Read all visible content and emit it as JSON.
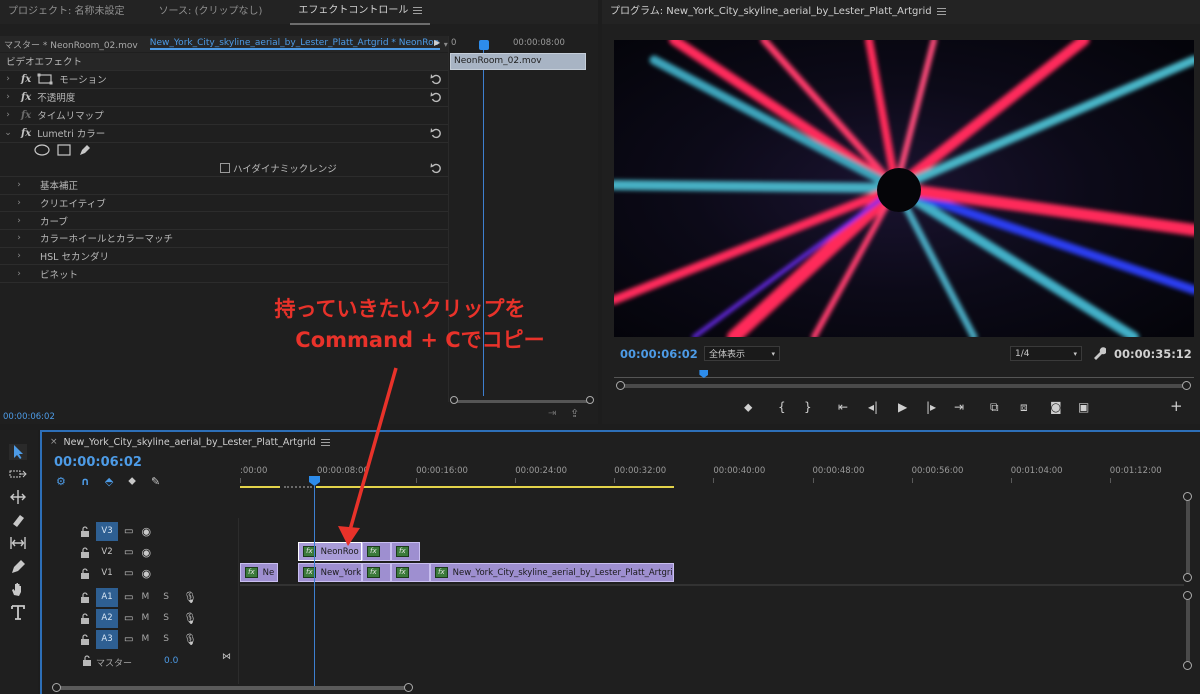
{
  "effect_panel": {
    "tabs": [
      {
        "label": "プロジェクト: 名称未設定",
        "active": false
      },
      {
        "label": "ソース: (クリップなし)",
        "active": false
      },
      {
        "label": "エフェクトコントロール",
        "active": true
      }
    ],
    "master_label": "マスター * NeonRoom_02.mov",
    "sequence_label": "New_York_City_skyline_aerial_by_Lester_Platt_Artgrid * NeonRoom_...",
    "timecode_start": "0",
    "timecode_mid": "00:00:08:00",
    "clip_name": "NeonRoom_02.mov",
    "section": "ビデオエフェクト",
    "effects": [
      {
        "label": "モーション",
        "dim": false
      },
      {
        "label": "不透明度",
        "dim": false
      },
      {
        "label": "タイムリマップ",
        "dim": true
      },
      {
        "label": "Lumetri カラー",
        "dim": false
      }
    ],
    "hdr_label": "ハイダイナミックレンジ",
    "lumetri_sections": [
      "基本補正",
      "クリエイティブ",
      "カーブ",
      "カラーホイールとカラーマッチ",
      "HSL セカンダリ",
      "ビネット"
    ],
    "current_time": "00:00:06:02"
  },
  "program": {
    "title": "プログラム: New_York_City_skyline_aerial_by_Lester_Platt_Artgrid",
    "timecode": "00:00:06:02",
    "zoom": "全体表示",
    "resolution": "1/4",
    "duration": "00:00:35:12",
    "playhead_progress": 0.155
  },
  "timeline": {
    "title": "New_York_City_skyline_aerial_by_Lester_Platt_Artgrid",
    "timecode": "00:00:06:02",
    "ruler": [
      ":00:00",
      "00:00:08:00",
      "00:00:16:00",
      "00:00:24:00",
      "00:00:32:00",
      "00:00:40:00",
      "00:00:48:00",
      "00:00:56:00",
      "00:01:04:00",
      "00:01:12:00"
    ],
    "tracks": [
      {
        "target": "V3",
        "name": "V3"
      },
      {
        "target": "V2",
        "name": "V2"
      },
      {
        "target": "V1",
        "name": "V1"
      },
      {
        "target": "A1",
        "name": "A1"
      },
      {
        "target": "A2",
        "name": "A2"
      },
      {
        "target": "A3",
        "name": "A3"
      }
    ],
    "mute": "M",
    "solo": "S",
    "master_label": "マスター",
    "master_value": "0.0",
    "clips_v2": [
      "NeonRoo"
    ],
    "clips_v1": [
      "Ne",
      "New_York",
      "New_York_City_skyline_aerial_by_Lester_Platt_Artgrid."
    ],
    "fx_badge": "fx"
  },
  "annotation": {
    "line1": "持っていきたいクリップを",
    "line2": "Command + Cでコピー",
    "color": "#e8322a"
  },
  "colors": {
    "accent": "#2d8ceb",
    "clip": "#9e8fd0",
    "workarea": "#e3d34a"
  }
}
